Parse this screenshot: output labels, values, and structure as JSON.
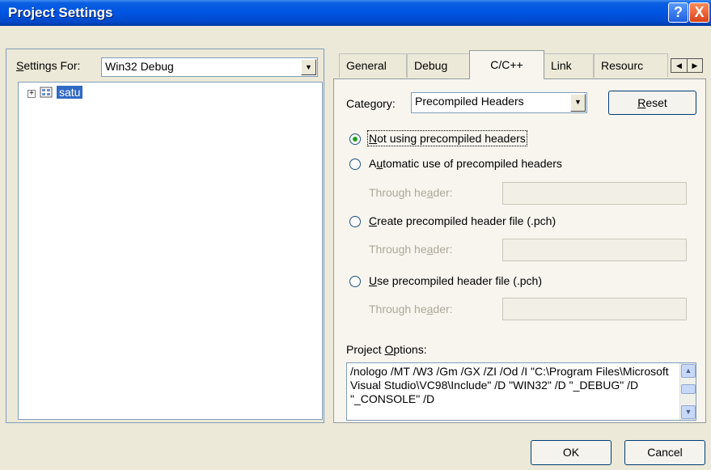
{
  "window": {
    "title": "Project Settings",
    "help_glyph": "?",
    "close_glyph": "X"
  },
  "left": {
    "settings_for_label_prefix": "S",
    "settings_for_label_rest": "ettings For:",
    "settings_for_value": "Win32 Debug",
    "tree": {
      "expander": "+",
      "item": "satu"
    }
  },
  "tabs": [
    "General",
    "Debug",
    "C/C++",
    "Link",
    "Resourc"
  ],
  "selected_tab": "C/C++",
  "cc": {
    "category_prefix": "Category",
    "category_underline": "y",
    "category_colon": ":",
    "category_value": "Precompiled Headers",
    "reset_first": "R",
    "reset_rest": "eset",
    "radios": [
      {
        "u": "N",
        "rest": "ot using precompiled headers",
        "checked": true
      },
      {
        "pre": "A",
        "u": "u",
        "rest": "tomatic use of precompiled headers",
        "checked": false
      },
      {
        "u": "C",
        "rest": "reate precompiled header file (.pch)",
        "checked": false
      },
      {
        "u": "U",
        "rest": "se precompiled header file (.pch)",
        "checked": false
      }
    ],
    "through_header_pre": "Through he",
    "through_header_u": "a",
    "through_header_post": "der:",
    "project_options_pre": "Project ",
    "project_options_u": "O",
    "project_options_post": "ptions:",
    "project_options_text": "/nologo /MT /W3 /Gm /GX /ZI /Od /I \"C:\\Program Files\\Microsoft Visual Studio\\VC98\\Include\" /D \"WIN32\" /D \"_DEBUG\" /D \"_CONSOLE\" /D"
  },
  "buttons": {
    "ok": "OK",
    "cancel": "Cancel"
  }
}
